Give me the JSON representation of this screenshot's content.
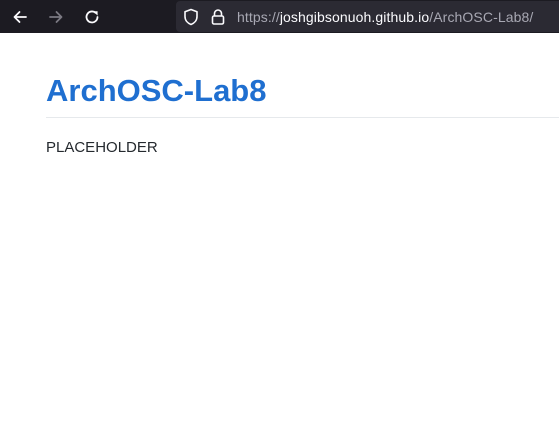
{
  "browser": {
    "back_icon": "back-arrow-icon",
    "forward_icon": "forward-arrow-icon",
    "reload_icon": "reload-icon",
    "security_icon": "shield-icon",
    "lock_icon": "lock-icon",
    "url": {
      "scheme": "https://",
      "domain": "joshgibsonuoh.github.io",
      "path": "/ArchOSC-Lab8/"
    },
    "colors": {
      "toolbar_bg": "#1c1b22",
      "urlbar_bg": "#2b2a33",
      "url_dim": "#a8a8b3",
      "url_bright": "#fbfbfe"
    }
  },
  "page": {
    "title": "ArchOSC-Lab8",
    "body": "PLACEHOLDER",
    "colors": {
      "title": "#1f6fd0",
      "text": "#24292e",
      "rule": "#e6e9ec"
    }
  }
}
